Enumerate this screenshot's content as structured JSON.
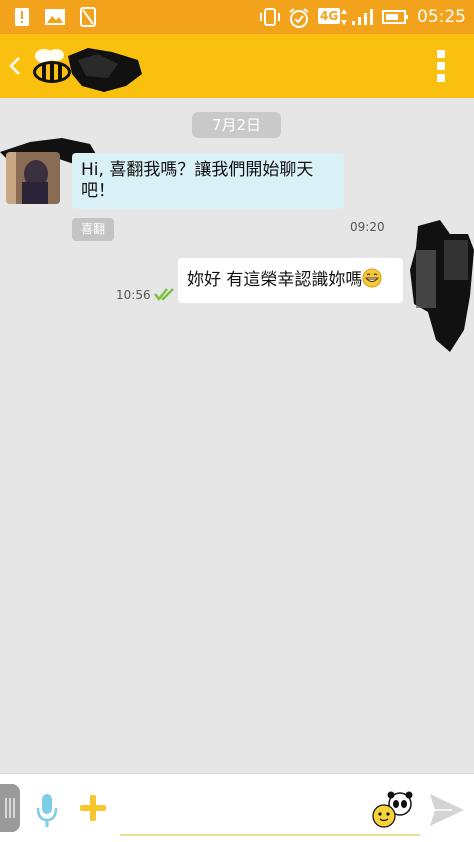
{
  "status_bar": {
    "time": "05:25",
    "network": "4G",
    "icons": [
      "alert-icon",
      "image-icon",
      "no-sim-icon",
      "vibrate-icon",
      "alarm-icon",
      "signal-icon",
      "battery-icon"
    ],
    "color": "#f3a21b"
  },
  "app_bar": {
    "color": "#f9c00f",
    "back_icon": "chevron-left-icon",
    "logo_icon": "bee-icon",
    "menu_icon": "more-vertical-icon"
  },
  "chat": {
    "date_divider": "7月2日",
    "incoming": {
      "text_line1": "Hi, 喜翻我嗎？讓我們開始聊天",
      "text_line2": "吧！",
      "sender_tag": "喜翻",
      "time": "09:20",
      "bubble_color": "#d8f0f6"
    },
    "outgoing": {
      "text": "妳好 有這榮幸認識妳嗎",
      "emoji": "grinning-face-icon",
      "time": "10:56",
      "status_icon": "double-check-icon",
      "bubble_color": "#ffffff"
    }
  },
  "composer": {
    "placeholder": "",
    "mic_icon": "microphone-icon",
    "plus_icon": "plus-icon",
    "sticker_icon": "sticker-icon",
    "send_icon": "send-icon"
  }
}
